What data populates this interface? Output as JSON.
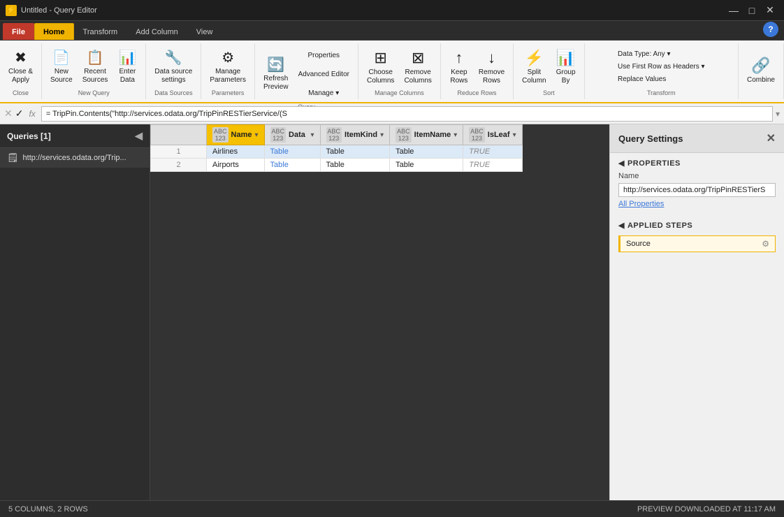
{
  "titleBar": {
    "icon": "⚡",
    "title": "Untitled - Query Editor",
    "minimizeIcon": "—",
    "maximizeIcon": "□",
    "closeIcon": "✕"
  },
  "ribbonTabs": {
    "file": "File",
    "home": "Home",
    "transform": "Transform",
    "addColumn": "Add Column",
    "view": "View"
  },
  "ribbon": {
    "close": {
      "label": "Close &\nApply",
      "icon": "✖"
    },
    "newSource": {
      "label": "New\nSource",
      "icon": "📄"
    },
    "recentSources": {
      "label": "Recent\nSources",
      "icon": "📋"
    },
    "enterData": {
      "label": "Enter\nData",
      "icon": "📊"
    },
    "dataSourceSettings": {
      "label": "Data source\nsettings",
      "icon": "🔧"
    },
    "manageParameters": {
      "label": "Manage\nParameters",
      "icon": "⚙"
    },
    "refreshPreview": {
      "label": "Refresh\nPreview",
      "icon": "🔄"
    },
    "properties": {
      "label": "Properties",
      "icon": "📋"
    },
    "advancedEditor": {
      "label": "Advanced Editor",
      "icon": "📝"
    },
    "manage": {
      "label": "Manage ▾",
      "icon": ""
    },
    "chooseColumns": {
      "label": "Choose\nColumns",
      "icon": "⊞"
    },
    "removeColumns": {
      "label": "Remove\nColumns",
      "icon": "⊠"
    },
    "keepRows": {
      "label": "Keep\nRows",
      "icon": "↑"
    },
    "removeRows": {
      "label": "Remove\nRows",
      "icon": "↓"
    },
    "splitColumn": {
      "label": "Split\nColumn",
      "icon": "⚡"
    },
    "groupBy": {
      "label": "Group\nBy",
      "icon": "📊"
    },
    "dataType": {
      "label": "Data Type: Any ▾"
    },
    "useFirstRow": {
      "label": "Use First Row as Headers ▾"
    },
    "replaceValues": {
      "label": "Replace Values"
    },
    "combine": {
      "label": "Combine",
      "icon": "🔗"
    },
    "closeGroup": "Close",
    "newQueryGroup": "New Query",
    "dataSourcesGroup": "Data Sources",
    "parametersGroup": "Parameters",
    "queryGroup": "Query",
    "manageColumnsGroup": "Manage Columns",
    "reduceRowsGroup": "Reduce Rows",
    "sortGroup": "Sort",
    "transformGroup": "Transform"
  },
  "formulaBar": {
    "cancelIcon": "✕",
    "confirmIcon": "✓",
    "fx": "fx",
    "formula": "= TripPin.Contents(\"http://services.odata.org/TripPinRESTierService/(S",
    "expandIcon": "▾"
  },
  "sidebar": {
    "title": "Queries [1]",
    "collapseIcon": "◀",
    "items": [
      {
        "icon": "🗒",
        "label": "http://services.odata.org/Trip..."
      }
    ]
  },
  "grid": {
    "columns": [
      {
        "type": "",
        "name": ""
      },
      {
        "type": "ABC\n123",
        "name": "Name"
      },
      {
        "type": "ABC\n123",
        "name": "Data"
      },
      {
        "type": "ABC\n123",
        "name": "ItemKind"
      },
      {
        "type": "ABC\n123",
        "name": "ItemName"
      },
      {
        "type": "ABC\n123",
        "name": "IsLeaf"
      }
    ],
    "rows": [
      {
        "num": "1",
        "name": "Airlines",
        "data": "Table",
        "itemKind": "Table",
        "itemName": "Table",
        "isLeaf": "TRUE"
      },
      {
        "num": "2",
        "name": "Airports",
        "data": "Table",
        "itemKind": "Table",
        "itemName": "Table",
        "isLeaf": "TRUE"
      }
    ]
  },
  "queryPanel": {
    "title": "Query Settings",
    "closeIcon": "✕",
    "propertiesSection": "PROPERTIES",
    "nameLabel": "Name",
    "nameValue": "http://services.odata.org/TripPinRESTierS",
    "allPropertiesLink": "All Properties",
    "appliedStepsSection": "APPLIED STEPS",
    "steps": [
      {
        "label": "Source",
        "gearIcon": "⚙"
      }
    ]
  },
  "statusBar": {
    "left": "5 COLUMNS, 2 ROWS",
    "right": "PREVIEW DOWNLOADED AT 11:17 AM"
  }
}
